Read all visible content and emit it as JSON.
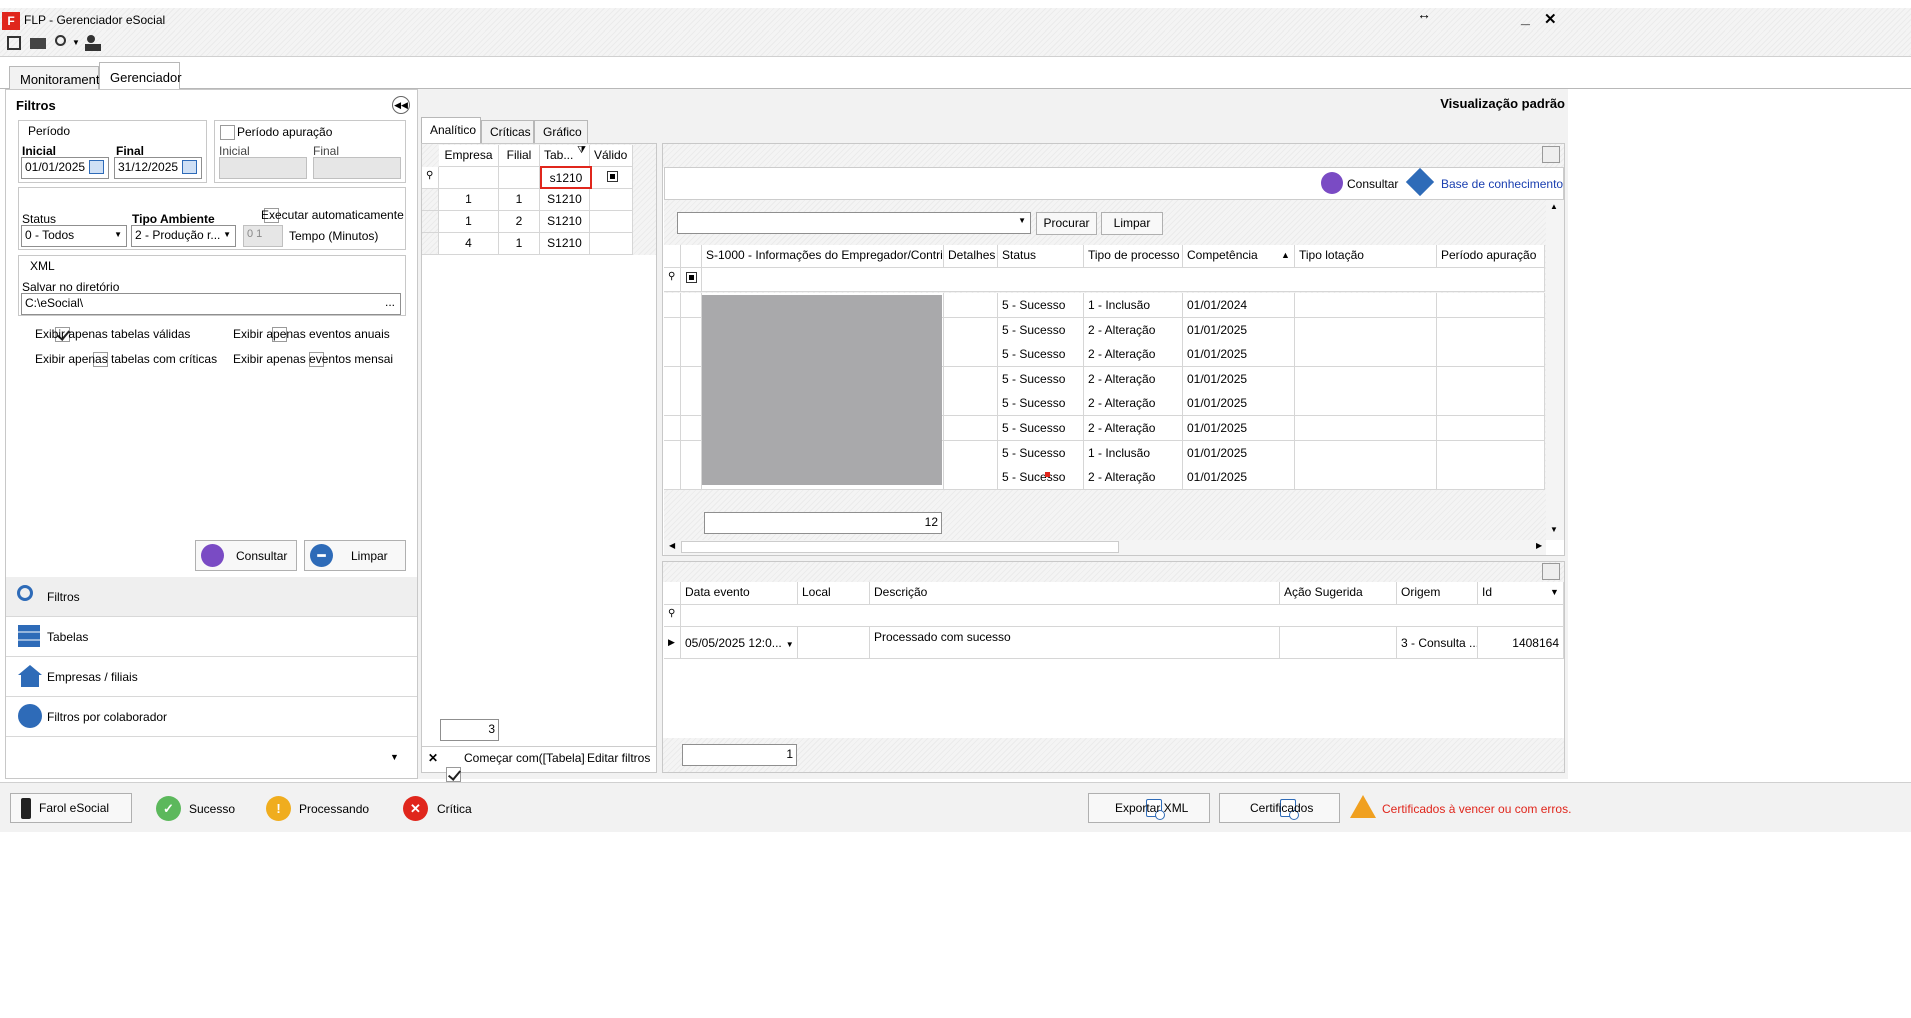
{
  "window": {
    "title": "FLP - Gerenciador eSocial",
    "app_icon_text": "F"
  },
  "main_tabs": [
    {
      "label": "Monitoramento"
    },
    {
      "label": "Gerenciador"
    }
  ],
  "filters": {
    "header": "Filtros",
    "periodo": {
      "legend": "Período",
      "inicial_label": "Inicial",
      "inicial_value": "01/01/2025",
      "final_label": "Final",
      "final_value": "31/12/2025"
    },
    "periodo_apuracao": {
      "label": "Período apuração",
      "inicial_label": "Inicial",
      "final_label": "Final"
    },
    "status_label": "Status",
    "status_value": "0 - Todos",
    "ambiente_label": "Tipo Ambiente",
    "ambiente_value": "2 - Produção r...",
    "auto_label": "Executar automaticamente",
    "tempo_value": "0    1",
    "tempo_label": "Tempo (Minutos)",
    "xml_legend": "XML",
    "salvar_label": "Salvar no diretório",
    "salvar_value": "C:\\eSocial\\",
    "browse": "...",
    "checks": [
      {
        "label": "Exibir apenas tabelas válidas",
        "checked": true
      },
      {
        "label": "Exibir apenas eventos anuais",
        "checked": false
      },
      {
        "label": "Exibir apenas tabelas com críticas",
        "checked": false
      },
      {
        "label": "Exibir apenas eventos mensai",
        "checked": false
      }
    ],
    "consultar": "Consultar",
    "limpar": "Limpar"
  },
  "nav": [
    {
      "label": "Filtros"
    },
    {
      "label": "Tabelas"
    },
    {
      "label": "Empresas / filiais"
    },
    {
      "label": "Filtros por colaborador"
    }
  ],
  "view_title": "Visualização padrão",
  "sub_tabs": [
    {
      "label": "Analítico"
    },
    {
      "label": "Críticas"
    },
    {
      "label": "Gráfico"
    }
  ],
  "left_grid": {
    "headers": [
      "Empresa",
      "Filial",
      "Tab...",
      "Válido"
    ],
    "filter_value": "s1210",
    "rows": [
      [
        "1",
        "1",
        "S1210"
      ],
      [
        "1",
        "2",
        "S1210"
      ],
      [
        "4",
        "1",
        "S1210"
      ]
    ],
    "count": "3",
    "filter_text": "Começar com([Tabela]...",
    "edit_filters": "Editar filtros"
  },
  "toolbar": {
    "consultar": "Consultar",
    "base": "Base de conhecimento",
    "procurar": "Procurar",
    "limpar": "Limpar"
  },
  "main_grid": {
    "headers": [
      "S-1000 - Informações do Empregador/Contri...",
      "Detalhes",
      "Status",
      "Tipo de processo",
      "Competência",
      "Tipo lotação",
      "Período apuração"
    ],
    "rows": [
      [
        "5 - Sucesso",
        "1 - Inclusão",
        "01/01/2024"
      ],
      [
        "5 - Sucesso",
        "2 - Alteração",
        "01/01/2025"
      ],
      [
        "5 - Sucesso",
        "2 - Alteração",
        "01/01/2025"
      ],
      [
        "5 - Sucesso",
        "2 - Alteração",
        "01/01/2025"
      ],
      [
        "5 - Sucesso",
        "2 - Alteração",
        "01/01/2025"
      ],
      [
        "5 - Sucesso",
        "2 - Alteração",
        "01/01/2025"
      ],
      [
        "5 - Sucesso",
        "1 - Inclusão",
        "01/01/2025"
      ],
      [
        "5 - Sucesso",
        "2 - Alteração",
        "01/01/2025"
      ]
    ],
    "count": "12"
  },
  "bottom_grid": {
    "headers": [
      "Data evento",
      "Local",
      "Descrição",
      "Ação Sugerida",
      "Origem",
      "Id"
    ],
    "row": {
      "data": "05/05/2025 12:0...",
      "descricao": "Processado com sucesso",
      "origem": "3 - Consulta ...",
      "id": "1408164"
    },
    "count": "1"
  },
  "statusbar": {
    "farol": "Farol eSocial",
    "sucesso": "Sucesso",
    "processando": "Processando",
    "critica": "Crítica",
    "exportar": "Exportar XML",
    "certificados": "Certificados",
    "warning": "Certificados à vencer ou com erros."
  },
  "colors": {
    "accent": "#2e6bb8",
    "red": "#e0261c",
    "green": "#5cb85c",
    "orange": "#f0ad1e",
    "purple": "#7a4bc4"
  }
}
